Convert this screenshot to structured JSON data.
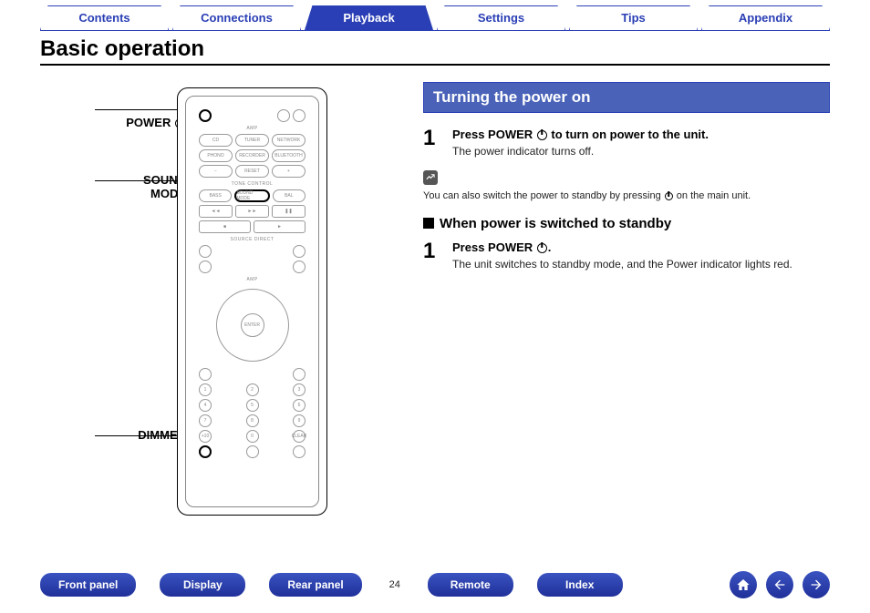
{
  "topTabs": {
    "items": [
      {
        "label": "Contents",
        "active": false
      },
      {
        "label": "Connections",
        "active": false
      },
      {
        "label": "Playback",
        "active": true
      },
      {
        "label": "Settings",
        "active": false
      },
      {
        "label": "Tips",
        "active": false
      },
      {
        "label": "Appendix",
        "active": false
      }
    ]
  },
  "pageTitle": "Basic operation",
  "remote": {
    "callouts": {
      "power": "POWER",
      "soundMode": "SOUND\nMODE",
      "dimmer": "DIMMER"
    }
  },
  "section": {
    "turningPowerOn": {
      "header": "Turning the power on",
      "step1": {
        "num": "1",
        "titlePrefix": "Press POWER ",
        "titleSuffix": " to turn on power to the unit.",
        "text": "The power indicator turns off."
      },
      "notePrefix": "You can also switch the power to standby by pressing ",
      "noteSuffix": " on the main unit.",
      "standbyHeader": "When power is switched to standby",
      "standbyStep": {
        "num": "1",
        "title": "Press POWER ",
        "titleSuffix": ".",
        "text": "The unit switches to standby mode, and the Power indicator lights red."
      }
    }
  },
  "bottom": {
    "items": [
      "Front panel",
      "Display",
      "Rear panel"
    ],
    "pageNum": "24",
    "items2": [
      "Remote",
      "Index"
    ],
    "icons": [
      "home-icon",
      "prev-icon",
      "next-icon"
    ]
  }
}
